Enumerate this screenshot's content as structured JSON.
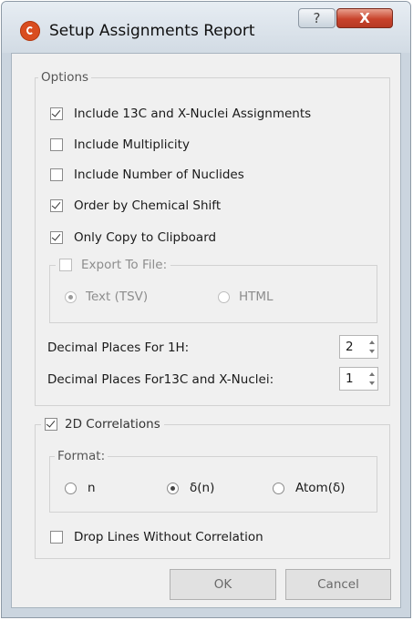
{
  "window": {
    "title": "Setup Assignments Report",
    "help_glyph": "?",
    "close_glyph": "X",
    "app_icon": "mnova-logo-icon"
  },
  "options": {
    "legend": "Options",
    "include_13c": {
      "label": "Include 13C and X-Nuclei Assignments",
      "checked": true
    },
    "include_multiplicity": {
      "label": "Include Multiplicity",
      "checked": false
    },
    "include_nuclides": {
      "label": "Include Number of Nuclides",
      "checked": false
    },
    "order_by_shift": {
      "label": "Order by Chemical Shift",
      "checked": true
    },
    "only_clipboard": {
      "label": "Only Copy to Clipboard",
      "checked": true
    },
    "export": {
      "legend": "Export To File:",
      "checked": false,
      "text_tsv": "Text (TSV)",
      "html": "HTML",
      "selected": "Text (TSV)"
    },
    "decimal_1h": {
      "label": "Decimal Places For 1H:",
      "value": "2"
    },
    "decimal_13c": {
      "label": "Decimal Places For13C and X-Nuclei:",
      "value": "1"
    }
  },
  "correlations": {
    "legend": "2D Correlations",
    "checked": true,
    "format": {
      "legend": "Format:",
      "opt_n": "n",
      "opt_delta": "δ(n)",
      "opt_atom": "Atom(δ)",
      "selected": "δ(n)"
    },
    "drop_lines": {
      "label": "Drop Lines Without Correlation",
      "checked": false
    }
  },
  "buttons": {
    "ok": "OK",
    "cancel": "Cancel"
  }
}
